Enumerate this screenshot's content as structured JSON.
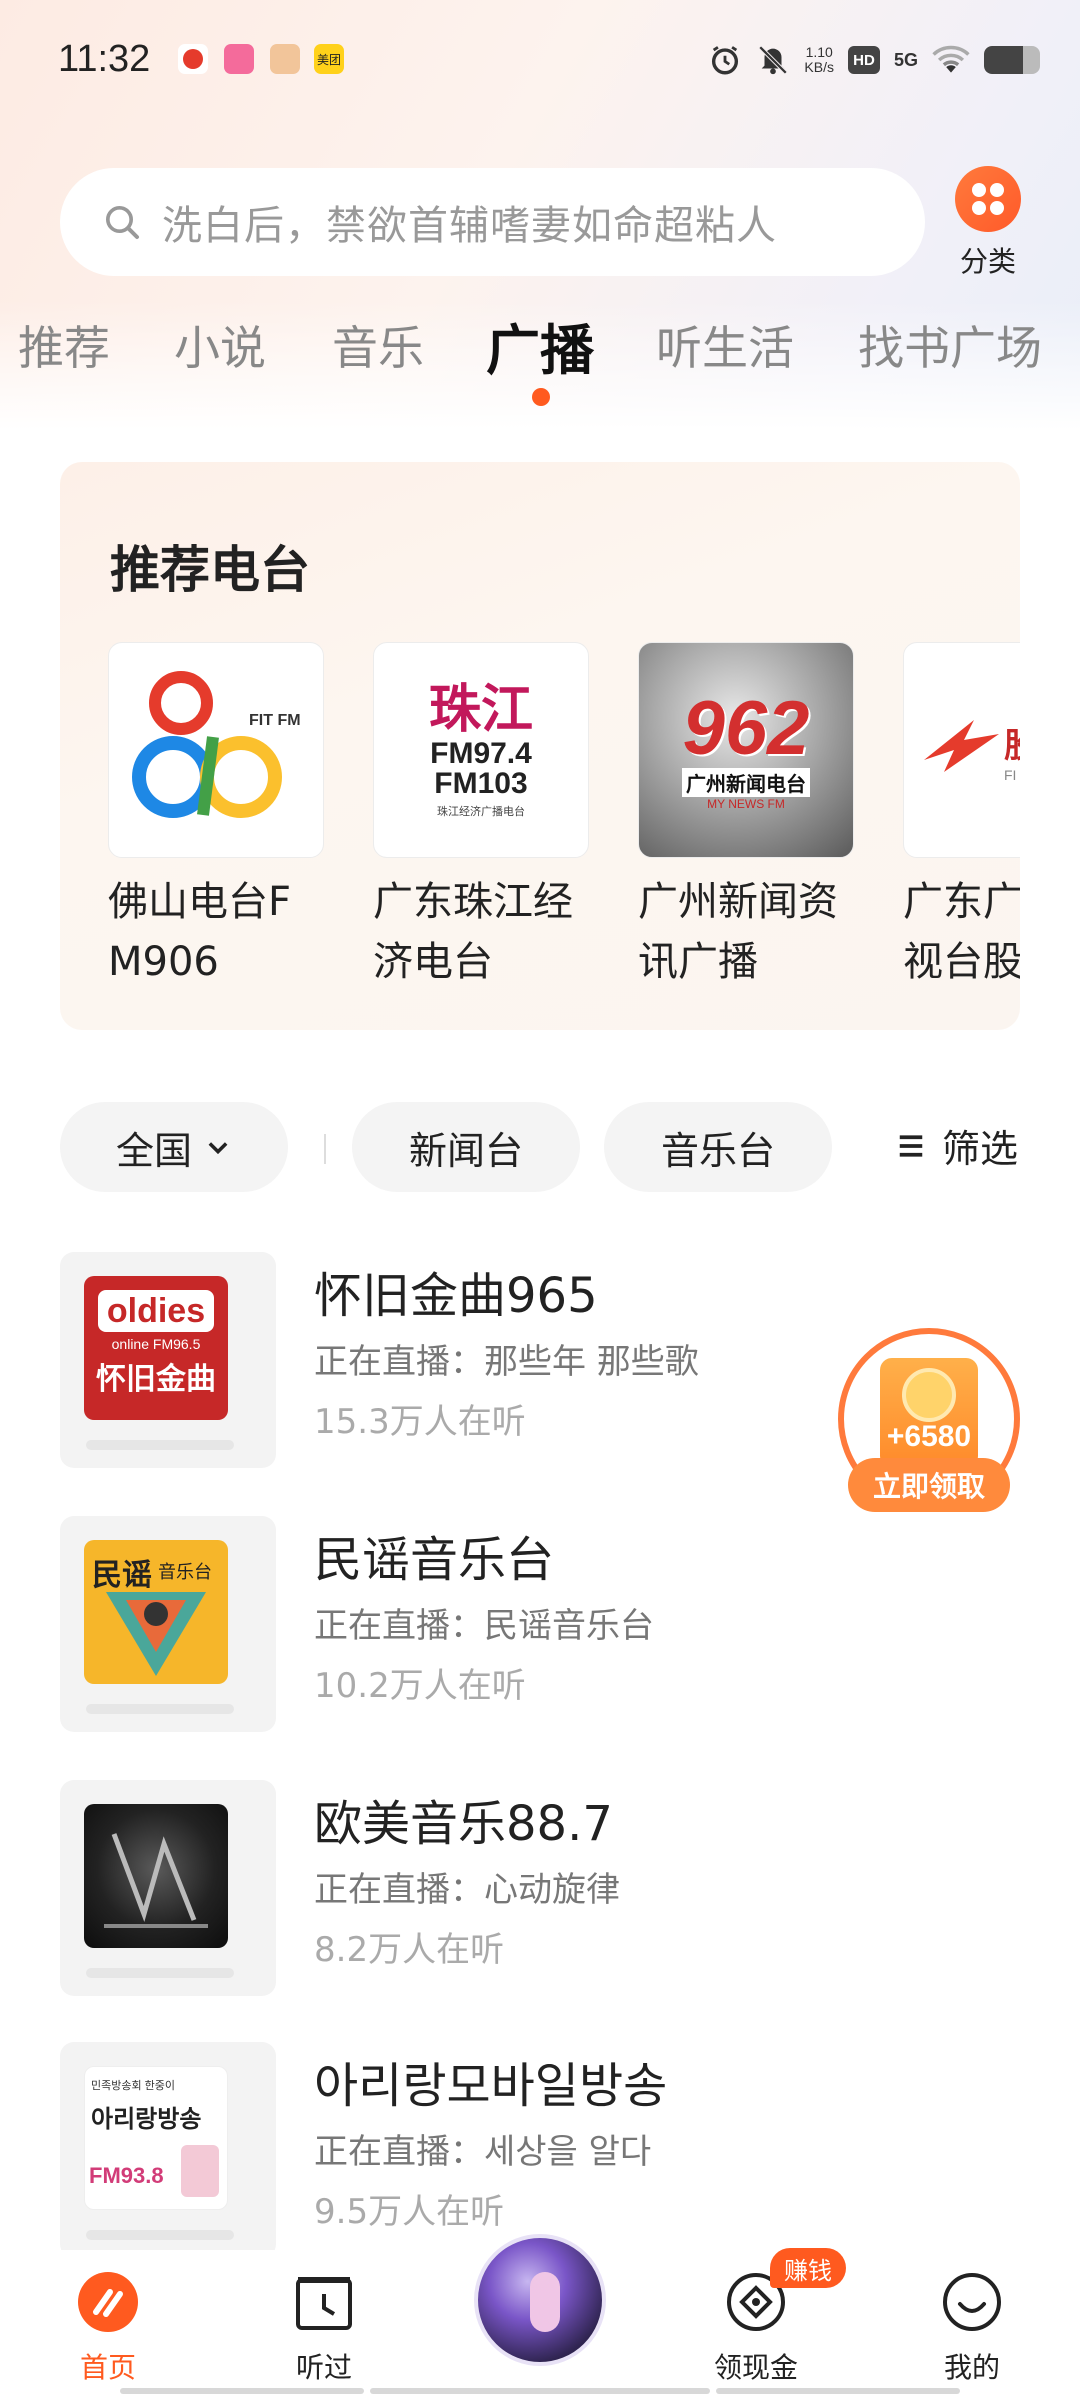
{
  "status_bar": {
    "time": "11:32",
    "net_speed_value": "1.10",
    "net_speed_unit": "KB/s",
    "hd": "HD",
    "network": "5G",
    "battery_level": 0.7,
    "notification_icons": [
      "app-icon-red",
      "bilibili-icon",
      "game-icon",
      "meituan-icon"
    ],
    "meituan_label": "美团"
  },
  "search": {
    "placeholder": "洗白后，禁欲首辅嗜妻如命超粘人"
  },
  "category": {
    "label": "分类"
  },
  "tabs": [
    {
      "label": "推荐"
    },
    {
      "label": "小说"
    },
    {
      "label": "音乐"
    },
    {
      "label": "广播",
      "active": true
    },
    {
      "label": "听生活"
    },
    {
      "label": "找书广场"
    }
  ],
  "recommended": {
    "title": "推荐电台",
    "stations": [
      {
        "name": "佛山电台FM906",
        "logo_text": "FIT FM"
      },
      {
        "name": "广东珠江经济电台",
        "logo_text": [
          "珠江",
          "FM97.4",
          "FM103",
          "珠江经济广播电台"
        ]
      },
      {
        "name": "广州新闻资讯广播",
        "logo_text": [
          "962",
          "广州新闻电台",
          "MY NEWS FM"
        ]
      },
      {
        "name": "广东广播电视台股",
        "logo_text": [
          "股市",
          "FI"
        ]
      }
    ]
  },
  "filters": {
    "region": "全国",
    "chips": [
      "新闻台",
      "音乐台"
    ],
    "filter_label": "筛选"
  },
  "list": [
    {
      "title": "怀旧金曲965",
      "live": "正在直播：那些年 那些歌",
      "listeners": "15.3万人在听",
      "cover_text": [
        "oldies",
        "online FM96.5",
        "怀旧金曲"
      ]
    },
    {
      "title": "民谣音乐台",
      "live": "正在直播：民谣音乐台",
      "listeners": "10.2万人在听",
      "cover_text": [
        "民谣",
        "音乐台"
      ]
    },
    {
      "title": "欧美音乐88.7",
      "live": "正在直播：心动旋律",
      "listeners": "8.2万人在听",
      "cover_text": []
    },
    {
      "title": "아리랑모바일방송",
      "live": "正在直播：세상을 알다",
      "listeners": "9.5万人在听",
      "cover_text": [
        "민족방송회 한중이",
        "아리랑방송",
        "FM93.8"
      ]
    }
  ],
  "reward": {
    "points": "+6580",
    "claim": "立即领取"
  },
  "bottom_nav": {
    "items": [
      {
        "label": "首页",
        "active": true
      },
      {
        "label": "听过"
      },
      {
        "label": "领现金",
        "badge": "赚钱"
      },
      {
        "label": "我的"
      }
    ]
  },
  "colors": {
    "accent": "#ff5a1f",
    "tab_active": "#111111",
    "muted": "#888888"
  }
}
